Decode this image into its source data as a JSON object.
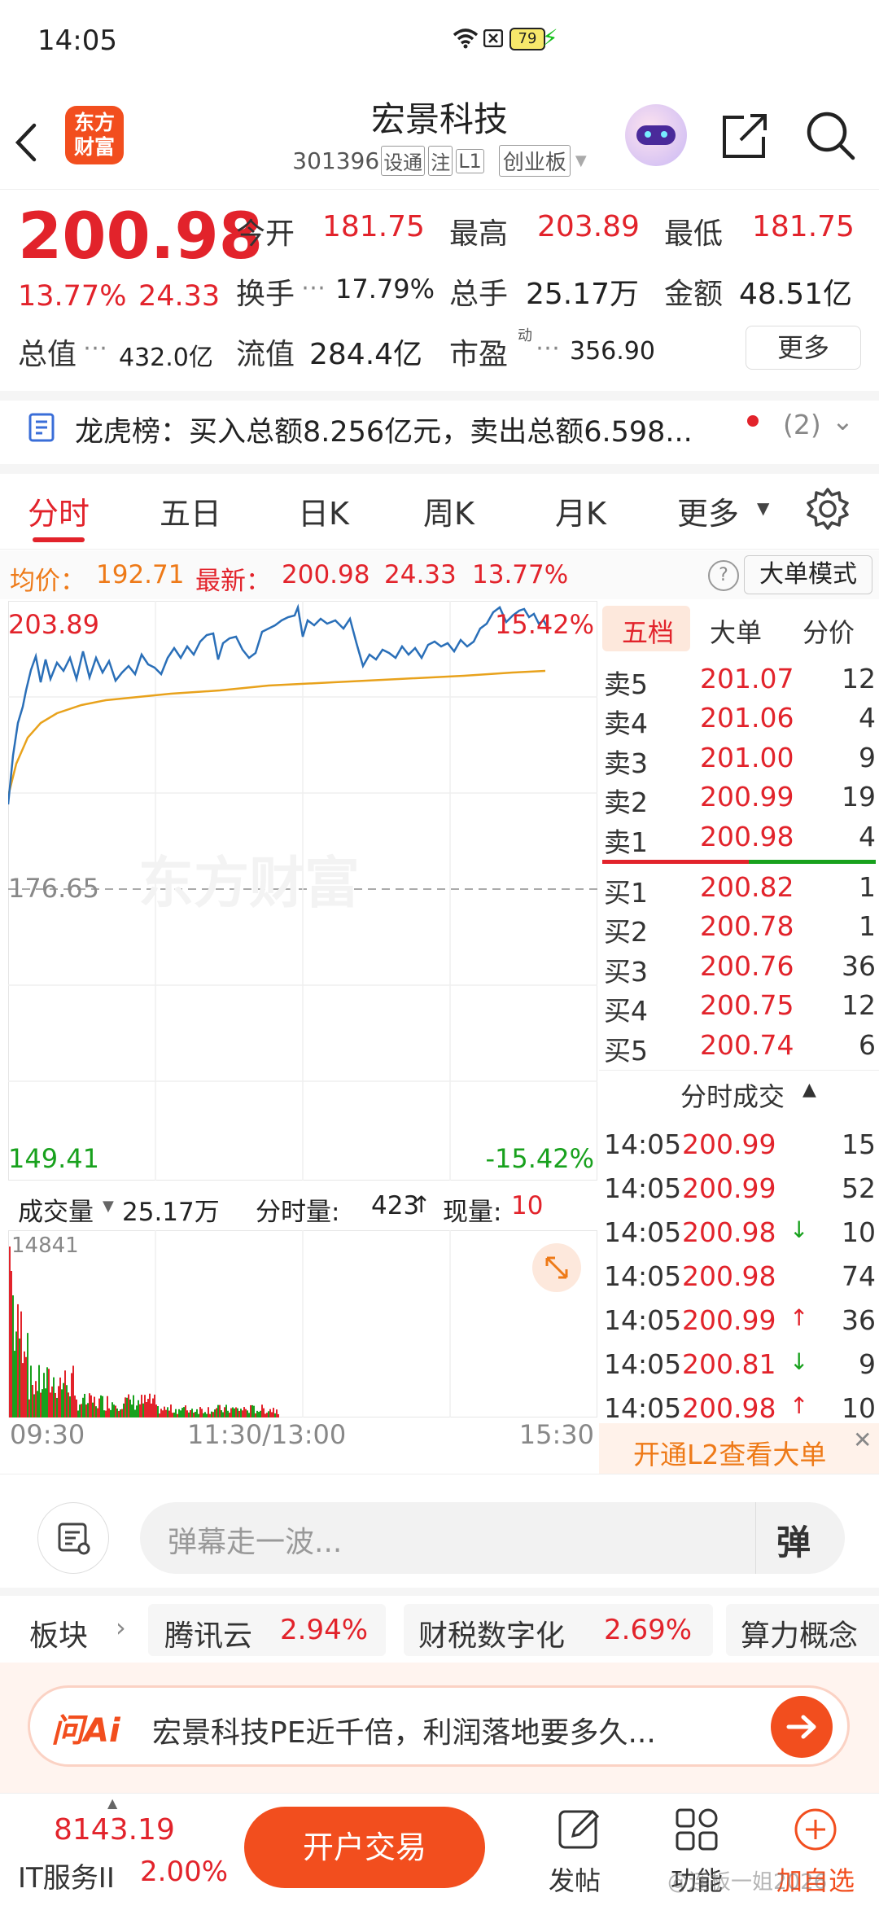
{
  "status": {
    "time": "14:05",
    "battery": "79"
  },
  "header": {
    "logo": "东方财富",
    "name": "宏景科技",
    "code": "301396",
    "badges": [
      "设通",
      "注",
      "L1"
    ],
    "board": "创业板"
  },
  "quote": {
    "price": "200.98",
    "pct": "13.77%",
    "change": "24.33",
    "open_label": "今开",
    "open": "181.75",
    "high_label": "最高",
    "high": "203.89",
    "low_label": "最低",
    "low": "181.75",
    "turnover_label": "换手",
    "turnover": "17.79%",
    "volume_label": "总手",
    "volume": "25.17万",
    "amount_label": "金额",
    "amount": "48.51亿",
    "mktcap_label": "总值",
    "mktcap": "432.0亿",
    "float_label": "流值",
    "float": "284.4亿",
    "pe_label": "市盈",
    "pe_sup": "动",
    "pe": "356.90",
    "more": "更多"
  },
  "longhu": {
    "text": "龙虎榜：买入总额8.256亿元，卖出总额6.598...",
    "count": "(2)"
  },
  "tabs": [
    "分时",
    "五日",
    "日K",
    "周K",
    "月K",
    "更多"
  ],
  "infoline": {
    "avg_label": "均价：",
    "avg": "192.71",
    "latest_label": "最新：",
    "latest": "200.98",
    "change": "24.33",
    "pct": "13.77%",
    "mode": "大单模式"
  },
  "chart": {
    "watermark": "东方财富",
    "top_price": "203.89",
    "top_pct": "15.42%",
    "mid_price": "176.65",
    "bottom_price": "149.41",
    "bottom_pct": "-15.42%",
    "vol_label": "成交量",
    "vol_total": "25.17万",
    "tick_label": "分时量:",
    "tick": "423",
    "cur_label": "现量:",
    "cur": "10",
    "vol_max": "14841",
    "times": [
      "09:30",
      "11:30/13:00",
      "15:30"
    ]
  },
  "book": {
    "tabs": [
      "五档",
      "大单",
      "分价"
    ],
    "sells": [
      {
        "label": "卖5",
        "price": "201.07",
        "vol": "12"
      },
      {
        "label": "卖4",
        "price": "201.06",
        "vol": "4"
      },
      {
        "label": "卖3",
        "price": "201.00",
        "vol": "9"
      },
      {
        "label": "卖2",
        "price": "200.99",
        "vol": "19"
      },
      {
        "label": "卖1",
        "price": "200.98",
        "vol": "4"
      }
    ],
    "buys": [
      {
        "label": "买1",
        "price": "200.82",
        "vol": "1"
      },
      {
        "label": "买2",
        "price": "200.78",
        "vol": "1"
      },
      {
        "label": "买3",
        "price": "200.76",
        "vol": "36"
      },
      {
        "label": "买4",
        "price": "200.75",
        "vol": "12"
      },
      {
        "label": "买5",
        "price": "200.74",
        "vol": "6"
      }
    ],
    "trades_title": "分时成交",
    "trades": [
      {
        "time": "14:05",
        "price": "200.99",
        "arrow": "",
        "vol": "15",
        "vc": "green"
      },
      {
        "time": "14:05",
        "price": "200.99",
        "arrow": "",
        "vol": "52",
        "vc": "green"
      },
      {
        "time": "14:05",
        "price": "200.98",
        "arrow": "↓",
        "vol": "10",
        "vc": "green"
      },
      {
        "time": "14:05",
        "price": "200.98",
        "arrow": "",
        "vol": "74",
        "vc": "green"
      },
      {
        "time": "14:05",
        "price": "200.99",
        "arrow": "↑",
        "vol": "36",
        "vc": "red"
      },
      {
        "time": "14:05",
        "price": "200.81",
        "arrow": "↓",
        "vol": "9",
        "vc": "green"
      },
      {
        "time": "14:05",
        "price": "200.98",
        "arrow": "↑",
        "vol": "10",
        "vc": "red"
      }
    ],
    "l2_banner": "开通L2查看大单"
  },
  "danmu": {
    "placeholder": "弹幕走一波...",
    "btn": "弹"
  },
  "sector": {
    "label": "板块",
    "items": [
      {
        "name": "腾讯云",
        "pct": "2.94%"
      },
      {
        "name": "财税数字化",
        "pct": "2.69%"
      },
      {
        "name": "算力概念",
        "pct": ""
      }
    ]
  },
  "askai": {
    "brand": "问Ai",
    "text": "宏景科技PE近千倍，利润落地要多久..."
  },
  "bottom": {
    "index_val": "8143.19",
    "index_name": "IT服务II",
    "index_pct": "2.00%",
    "trade_btn": "开户交易",
    "post": "发帖",
    "func": "功能",
    "add": "加自选",
    "watermark": "@连板一姐2026"
  },
  "colors": {
    "up": "#e2232b",
    "down": "#18a11d",
    "accent": "#f24e1e",
    "price_line": "#2a6fb8",
    "avg_line": "#e8a21c"
  }
}
